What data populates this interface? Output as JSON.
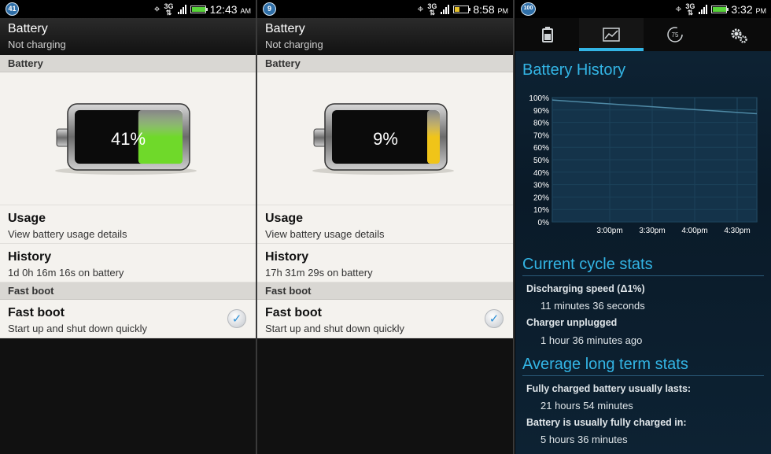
{
  "panels": [
    {
      "status": {
        "notification": "41",
        "time": "12:43",
        "ampm": "AM",
        "battery_color": "#58d43a"
      },
      "title": "Battery",
      "subtitle": "Not charging",
      "section_battery": "Battery",
      "battery_percent_text": "41%",
      "battery_level": 0.41,
      "battery_color": "#6fd92a",
      "usage": {
        "title": "Usage",
        "subtitle": "View battery usage details"
      },
      "history": {
        "title": "History",
        "subtitle": "1d 0h 16m 16s on battery"
      },
      "section_fastboot": "Fast boot",
      "fastboot": {
        "title": "Fast boot",
        "subtitle": "Start up and shut down quickly",
        "checked": true
      }
    },
    {
      "status": {
        "notification": "9",
        "time": "8:58",
        "ampm": "PM",
        "battery_color": "#e8c22a"
      },
      "title": "Battery",
      "subtitle": "Not charging",
      "section_battery": "Battery",
      "battery_percent_text": "9%",
      "battery_level": 0.09,
      "battery_color": "#f0c419",
      "usage": {
        "title": "Usage",
        "subtitle": "View battery usage details"
      },
      "history": {
        "title": "History",
        "subtitle": "17h 31m 29s on battery"
      },
      "section_fastboot": "Fast boot",
      "fastboot": {
        "title": "Fast boot",
        "subtitle": "Start up and shut down quickly",
        "checked": true
      }
    }
  ],
  "app": {
    "status": {
      "notification": "100",
      "time": "3:32",
      "ampm": "PM",
      "battery_color": "#58d43a"
    },
    "tabs": [
      "battery-icon",
      "chart-icon",
      "gauge-icon",
      "gears-icon"
    ],
    "active_tab": 1,
    "tab_gauge_text": "75",
    "history_title": "Battery History",
    "cycle_title": "Current cycle stats",
    "discharging_label": "Discharging speed (Δ1%)",
    "discharging_value": "11 minutes 36 seconds",
    "unplugged_label": "Charger unplugged",
    "unplugged_value": "1 hour 36 minutes ago",
    "longterm_title": "Average long term stats",
    "full_lasts_label": "Fully charged battery usually lasts:",
    "full_lasts_value": "21 hours 54 minutes",
    "charged_in_label": "Battery is usually fully charged in:",
    "charged_in_value": "5 hours 36 minutes"
  },
  "chart_data": {
    "type": "area",
    "title": "Battery History",
    "xlabel": "",
    "ylabel": "",
    "y_ticks": [
      "100%",
      "90%",
      "80%",
      "70%",
      "60%",
      "50%",
      "40%",
      "30%",
      "20%",
      "10%",
      "0%"
    ],
    "x_ticks": [
      "3:00pm",
      "3:30pm",
      "4:00pm",
      "4:30pm"
    ],
    "ylim": [
      0,
      100
    ],
    "grid": true,
    "series": [
      {
        "points": [
          [
            0,
            98
          ],
          [
            1,
            87
          ]
        ]
      }
    ],
    "line_color": "#4f8aa6",
    "fill_color": "#173b52"
  }
}
